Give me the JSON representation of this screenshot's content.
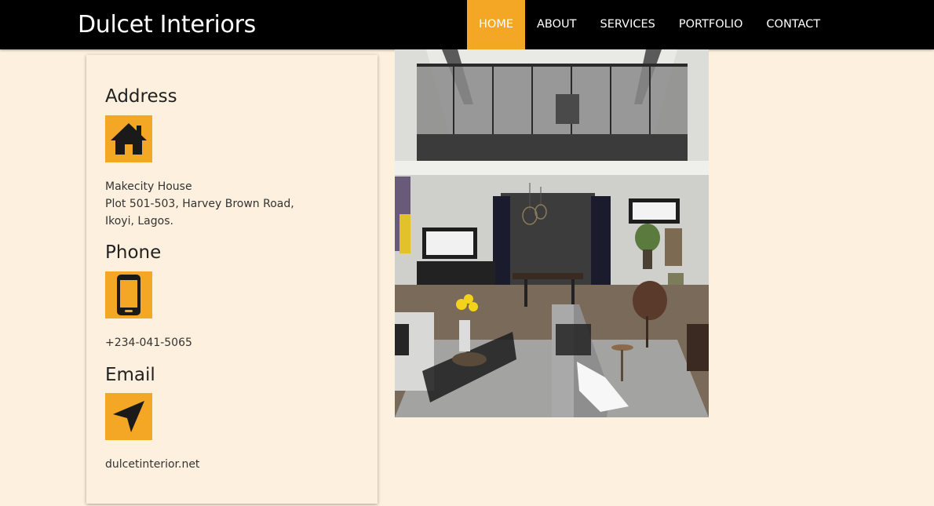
{
  "header": {
    "brand": "Dulcet Interiors",
    "nav": [
      {
        "label": "HOME",
        "active": true
      },
      {
        "label": "ABOUT"
      },
      {
        "label": "SERVICES"
      },
      {
        "label": "PORTFOLIO"
      },
      {
        "label": "CONTACT"
      }
    ]
  },
  "contact": {
    "address": {
      "title": "Address",
      "icon": "home-icon",
      "lines": [
        "Makecity House",
        "Plot 501-503, Harvey Brown Road,",
        "Ikoyi, Lagos."
      ]
    },
    "phone": {
      "title": "Phone",
      "icon": "mobile-phone-icon",
      "value": "+234-041-5065"
    },
    "email": {
      "title": "Email",
      "icon": "send-icon",
      "value": "dulcetinterior.net"
    }
  },
  "colors": {
    "accent": "#f4a725",
    "header_bg": "#000000",
    "page_bg": "#fdf0de"
  }
}
